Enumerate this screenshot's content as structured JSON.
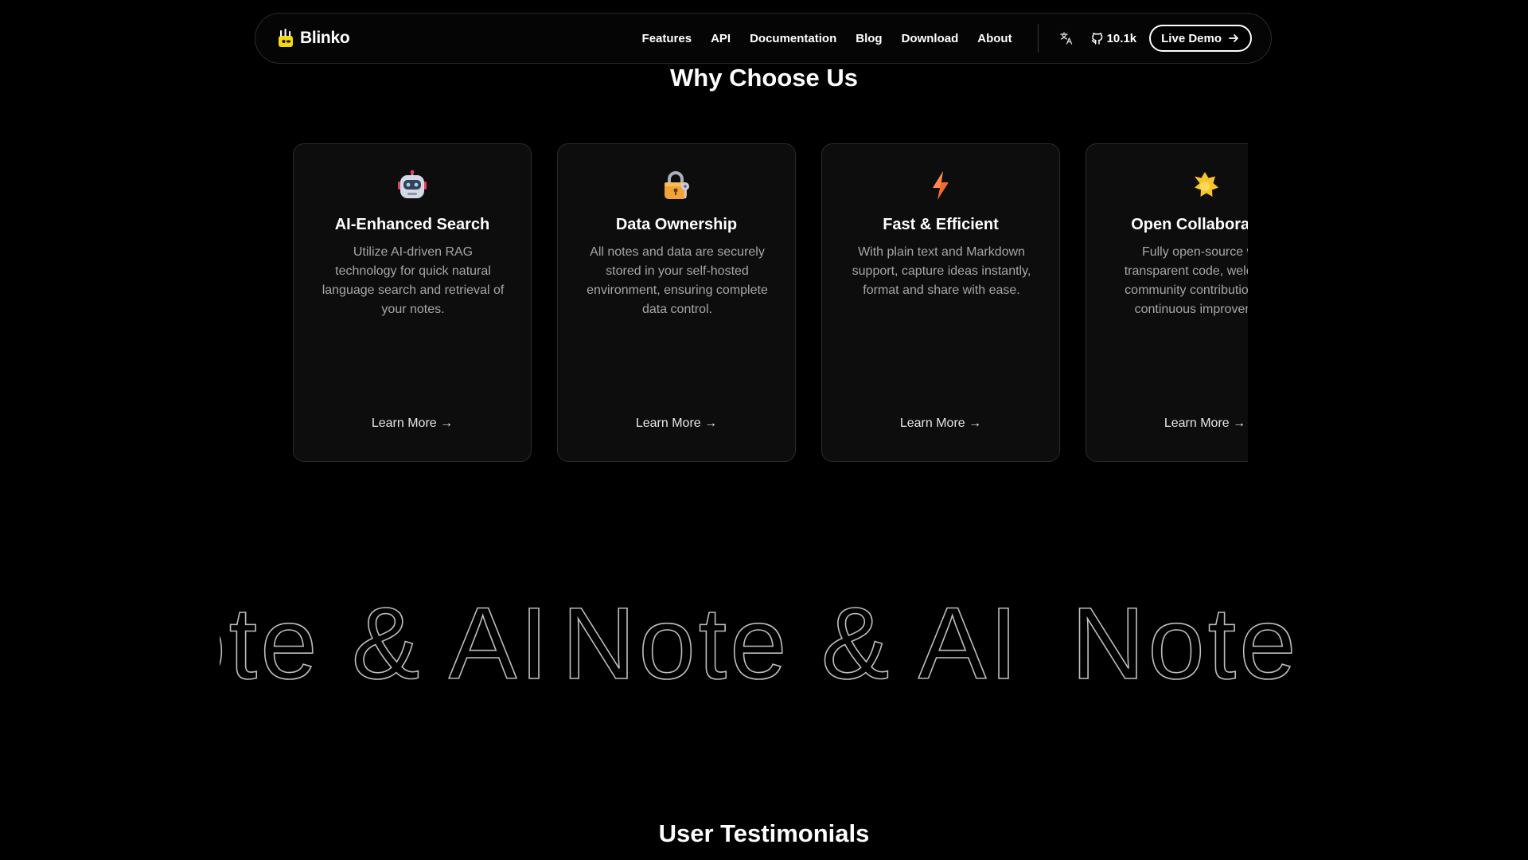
{
  "nav": {
    "logo_text": "Blinko",
    "links": [
      {
        "label": "Features"
      },
      {
        "label": "API"
      },
      {
        "label": "Documentation"
      },
      {
        "label": "Blog"
      },
      {
        "label": "Download"
      },
      {
        "label": "About"
      }
    ],
    "github_stars": "10.1k",
    "demo_label": "Live Demo"
  },
  "why": {
    "title": "Why Choose Us"
  },
  "cards": [
    {
      "icon": "robot-icon",
      "title": "AI-Enhanced Search",
      "description": "Utilize AI-driven RAG technology for quick natural language search and retrieval of your notes.",
      "link": "Learn More →"
    },
    {
      "icon": "lock-key-icon",
      "title": "Data Ownership",
      "description": "All notes and data are securely stored in your self-hosted environment, ensuring complete data control.",
      "link": "Learn More →"
    },
    {
      "icon": "lightning-icon",
      "title": "Fast & Efficient",
      "description": "With plain text and Markdown support, capture ideas instantly, format and share with ease.",
      "link": "Learn More →"
    },
    {
      "icon": "sparkle-icon",
      "title": "Open Collaboration",
      "description": "Fully open-source with transparent code, welcoming community contributions and continuous improvement.",
      "link": "Learn More →"
    }
  ],
  "marquee": {
    "text": "Note & AI"
  },
  "testimonials": {
    "title": "User Testimonials"
  },
  "colors": {
    "background": "#000000",
    "card_bg": "#0d0d0d",
    "border": "#2b2b2b",
    "muted_text": "#a6a6a6"
  }
}
